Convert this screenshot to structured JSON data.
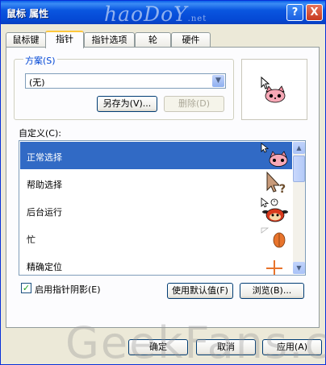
{
  "window": {
    "title": "鼠标 属性",
    "watermark_top": "haoDoY",
    "watermark_top_suffix": ".net",
    "help_label": "?",
    "close_label": "X"
  },
  "tabs": [
    {
      "label": "鼠标键",
      "active": false
    },
    {
      "label": "指针",
      "active": true
    },
    {
      "label": "指针选项",
      "active": false
    },
    {
      "label": "轮",
      "active": false
    },
    {
      "label": "硬件",
      "active": false
    }
  ],
  "scheme": {
    "group_label": "方案(S)",
    "selected_value": "(无)",
    "save_as_label": "另存为(V)...",
    "delete_label": "删除(D)"
  },
  "customize": {
    "label": "自定义(C):",
    "items": [
      {
        "label": "正常选择",
        "selected": true,
        "icon": "cat-normal-select-icon"
      },
      {
        "label": "帮助选择",
        "selected": false,
        "icon": "help-select-icon"
      },
      {
        "label": "后台运行",
        "selected": false,
        "icon": "working-in-background-icon"
      },
      {
        "label": "忙",
        "selected": false,
        "icon": "busy-icon"
      },
      {
        "label": "精确定位",
        "selected": false,
        "icon": "precision-select-icon"
      }
    ]
  },
  "shadow_checkbox": {
    "label": "启用指针阴影(E)",
    "checked": true
  },
  "use_default_label": "使用默认值(F)",
  "browse_label": "浏览(B)...",
  "footer": {
    "ok_label": "确定",
    "cancel_label": "取消",
    "apply_label": "应用(A)"
  },
  "watermark_bottom": "GeekFans.com",
  "colors": {
    "title_bar": "#0a56e0",
    "selection": "#316ac5",
    "tab_highlight": "#ffc83c",
    "dialog_bg": "#ece9d8"
  }
}
